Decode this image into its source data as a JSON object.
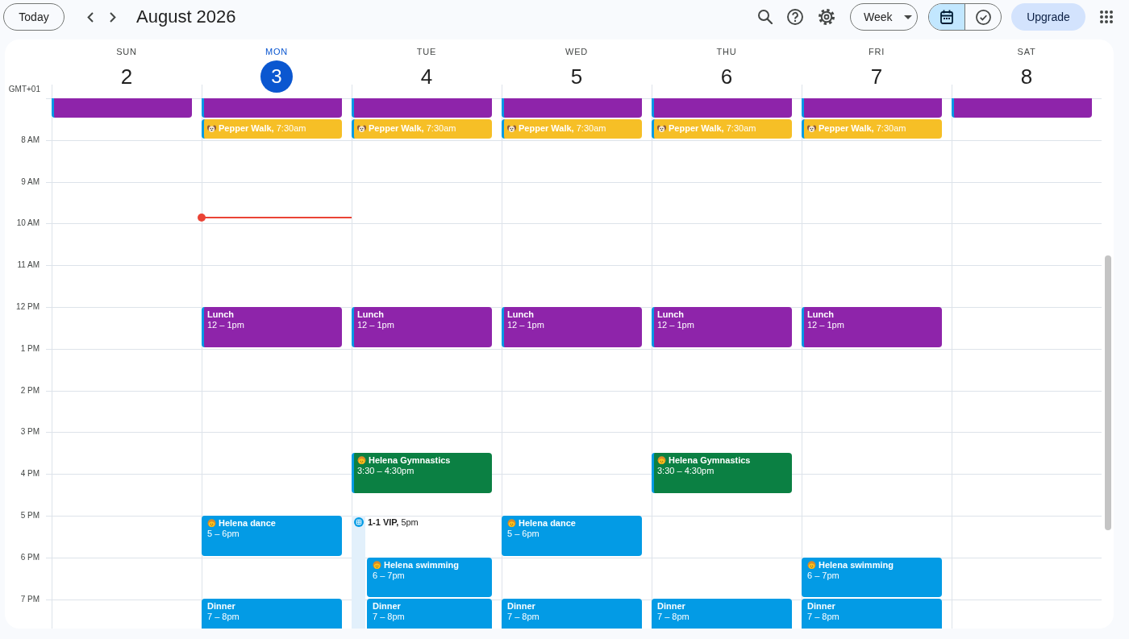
{
  "toolbar": {
    "today_button": "Today",
    "title": "August 2026",
    "view_select": "Week",
    "view_switch": [
      {
        "selected": true
      },
      {
        "selected": false
      }
    ],
    "upgrade_button": "Upgrade"
  },
  "timezone": "GMT+01",
  "hours": [
    "8 AM",
    "9 AM",
    "10 AM",
    "11 AM",
    "12 PM",
    "1 PM",
    "2 PM",
    "3 PM",
    "4 PM",
    "5 PM",
    "6 PM",
    "7 PM"
  ],
  "days": [
    {
      "name": "SUN",
      "date": "2",
      "today": false,
      "events": [
        {
          "kind": "clipped",
          "color": "#8e24aa"
        }
      ]
    },
    {
      "name": "MON",
      "date": "3",
      "today": true,
      "events": [
        {
          "kind": "clipped",
          "color": "#8e24aa"
        },
        {
          "kind": "pet-walk",
          "color": "#f6bf26",
          "label": "**Pepper Walk,** 7:30am"
        },
        {
          "kind": "meal",
          "color": "#8e24aa",
          "title": "Lunch",
          "time": "12 – 1pm"
        },
        {
          "kind": "kid-activity",
          "color": "#039be5",
          "title": "Helena dance",
          "time": "5 – 6pm"
        },
        {
          "kind": "meal",
          "color": "#039be5",
          "title": "Dinner",
          "time": "7 – 8pm"
        }
      ]
    },
    {
      "name": "TUE",
      "date": "4",
      "today": false,
      "events": [
        {
          "kind": "clipped",
          "color": "#8e24aa"
        },
        {
          "kind": "pet-walk",
          "color": "#f6bf26",
          "label": "**Pepper Walk,** 7:30am"
        },
        {
          "kind": "meal",
          "color": "#8e24aa",
          "title": "Lunch",
          "time": "12 – 1pm"
        },
        {
          "kind": "kid-activity",
          "color": "#0b8043",
          "title": "Helena Gymnastics",
          "time": "3:30 – 4:30pm"
        },
        {
          "kind": "appointment",
          "label": "**1-1 VIP,** 5pm"
        },
        {
          "kind": "kid-activity",
          "color": "#039be5",
          "title": "Helena swimming",
          "time": "6 – 7pm"
        },
        {
          "kind": "meal",
          "color": "#039be5",
          "title": "Dinner",
          "time": "7 – 8pm"
        }
      ]
    },
    {
      "name": "WED",
      "date": "5",
      "today": false,
      "events": [
        {
          "kind": "clipped",
          "color": "#8e24aa"
        },
        {
          "kind": "pet-walk",
          "color": "#f6bf26",
          "label": "**Pepper Walk,** 7:30am"
        },
        {
          "kind": "meal",
          "color": "#8e24aa",
          "title": "Lunch",
          "time": "12 – 1pm"
        },
        {
          "kind": "kid-activity",
          "color": "#039be5",
          "title": "Helena dance",
          "time": "5 – 6pm"
        },
        {
          "kind": "meal",
          "color": "#039be5",
          "title": "Dinner",
          "time": "7 – 8pm"
        }
      ]
    },
    {
      "name": "THU",
      "date": "6",
      "today": false,
      "events": [
        {
          "kind": "clipped",
          "color": "#8e24aa"
        },
        {
          "kind": "pet-walk",
          "color": "#f6bf26",
          "label": "**Pepper Walk,** 7:30am"
        },
        {
          "kind": "meal",
          "color": "#8e24aa",
          "title": "Lunch",
          "time": "12 – 1pm"
        },
        {
          "kind": "kid-activity",
          "color": "#0b8043",
          "title": "Helena Gymnastics",
          "time": "3:30 – 4:30pm"
        },
        {
          "kind": "meal",
          "color": "#039be5",
          "title": "Dinner",
          "time": "7 – 8pm"
        }
      ]
    },
    {
      "name": "FRI",
      "date": "7",
      "today": false,
      "events": [
        {
          "kind": "clipped",
          "color": "#8e24aa"
        },
        {
          "kind": "pet-walk",
          "color": "#f6bf26",
          "label": "**Pepper Walk,** 7:30am"
        },
        {
          "kind": "meal",
          "color": "#8e24aa",
          "title": "Lunch",
          "time": "12 – 1pm"
        },
        {
          "kind": "kid-activity",
          "color": "#039be5",
          "title": "Helena swimming",
          "time": "6 – 7pm"
        },
        {
          "kind": "meal",
          "color": "#039be5",
          "title": "Dinner",
          "time": "7 – 8pm"
        }
      ]
    },
    {
      "name": "SAT",
      "date": "8",
      "today": false,
      "events": [
        {
          "kind": "clipped",
          "color": "#8e24aa"
        }
      ]
    }
  ]
}
